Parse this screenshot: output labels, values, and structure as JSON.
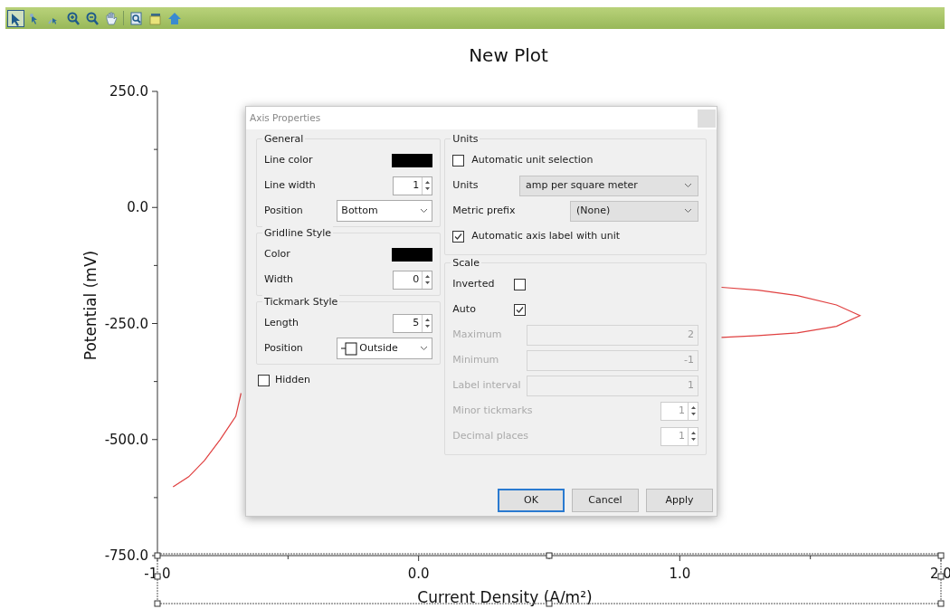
{
  "toolbar": {
    "tools": [
      {
        "kind": "pointer",
        "selected": true
      },
      {
        "kind": "pointer-small",
        "selected": false
      },
      {
        "kind": "pointer-tiny",
        "selected": false
      },
      {
        "kind": "zoom-in",
        "selected": false
      },
      {
        "kind": "zoom-out",
        "selected": false
      },
      {
        "kind": "pan",
        "selected": false
      },
      {
        "kind": "zoom-fit",
        "selected": false
      },
      {
        "kind": "folder",
        "selected": false
      },
      {
        "kind": "home",
        "selected": false
      }
    ]
  },
  "plot": {
    "chart_data": {
      "type": "line",
      "title": "New Plot",
      "xlabel": "Current Density (A/m²)",
      "ylabel": "Potential (mV)",
      "x": [
        -0.94,
        -0.88,
        -0.82,
        -0.76,
        -0.7,
        -0.68,
        null,
        1.16,
        1.3,
        1.45,
        1.6,
        1.69,
        1.6,
        1.45,
        1.3,
        1.16
      ],
      "series": [
        {
          "color": "#e04040",
          "values": [
            -602,
            -580,
            -545,
            -500,
            -450,
            -400,
            null,
            -172,
            -178,
            -190,
            -210,
            -233,
            -256,
            -270,
            -276,
            -280
          ]
        }
      ],
      "xlim": [
        -1,
        2
      ],
      "ylim": [
        -750,
        250
      ],
      "xticks": [
        {
          "value": -1,
          "label": "-1.0"
        },
        {
          "value": 0,
          "label": "0.0"
        },
        {
          "value": 1,
          "label": "1.0"
        },
        {
          "value": 2,
          "label": "2.0"
        }
      ],
      "yticks": [
        {
          "value": 250,
          "label": "250.0"
        },
        {
          "value": 0,
          "label": "0.0"
        },
        {
          "value": -250,
          "label": "-250.0"
        },
        {
          "value": -500,
          "label": "-500.0"
        },
        {
          "value": -750,
          "label": "-750.0"
        }
      ]
    },
    "x_axis_selected": true
  },
  "dialog": {
    "title": "Axis Properties",
    "general": {
      "title": "General",
      "rows": [
        {
          "kind": "color",
          "label": "Line color",
          "color": "#000000"
        },
        {
          "kind": "spin",
          "label": "Line width",
          "value": "1"
        },
        {
          "kind": "select",
          "label": "Position",
          "value": "Bottom"
        }
      ]
    },
    "gridline": {
      "title": "Gridline Style",
      "rows": [
        {
          "kind": "color",
          "label": "Color",
          "color": "#000000"
        },
        {
          "kind": "spin",
          "label": "Width",
          "value": "0"
        }
      ]
    },
    "tickmark": {
      "title": "Tickmark Style",
      "rows": [
        {
          "kind": "spin",
          "label": "Length",
          "value": "5"
        },
        {
          "kind": "tick-select",
          "label": "Position",
          "value": "Outside"
        }
      ]
    },
    "hidden": {
      "label": "Hidden",
      "checked": false
    },
    "units": {
      "title": "Units",
      "auto_unit": {
        "label": "Automatic unit selection",
        "checked": false
      },
      "rows": [
        {
          "kind": "wide-select",
          "label": "Units",
          "value": "amp per square meter"
        },
        {
          "kind": "narrow-select",
          "label": "Metric prefix",
          "value": "(None)"
        }
      ],
      "auto_label": {
        "label": "Automatic axis label with unit",
        "checked": true
      }
    },
    "scale": {
      "title": "Scale",
      "rows": [
        {
          "kind": "checkbox",
          "label": "Inverted",
          "checked": false
        },
        {
          "kind": "checkbox",
          "label": "Auto",
          "checked": true
        },
        {
          "kind": "text",
          "label": "Maximum",
          "value": "2",
          "disabled": true
        },
        {
          "kind": "text",
          "label": "Minimum",
          "value": "-1",
          "disabled": true
        },
        {
          "kind": "text",
          "label": "Label interval",
          "value": "1",
          "disabled": true
        },
        {
          "kind": "spin",
          "label": "Minor tickmarks",
          "value": "1",
          "disabled": true
        },
        {
          "kind": "spin",
          "label": "Decimal places",
          "value": "1",
          "disabled": true
        }
      ]
    },
    "buttons": [
      {
        "label": "OK",
        "focused": true
      },
      {
        "label": "Cancel",
        "focused": false
      },
      {
        "label": "Apply",
        "focused": false
      }
    ]
  }
}
